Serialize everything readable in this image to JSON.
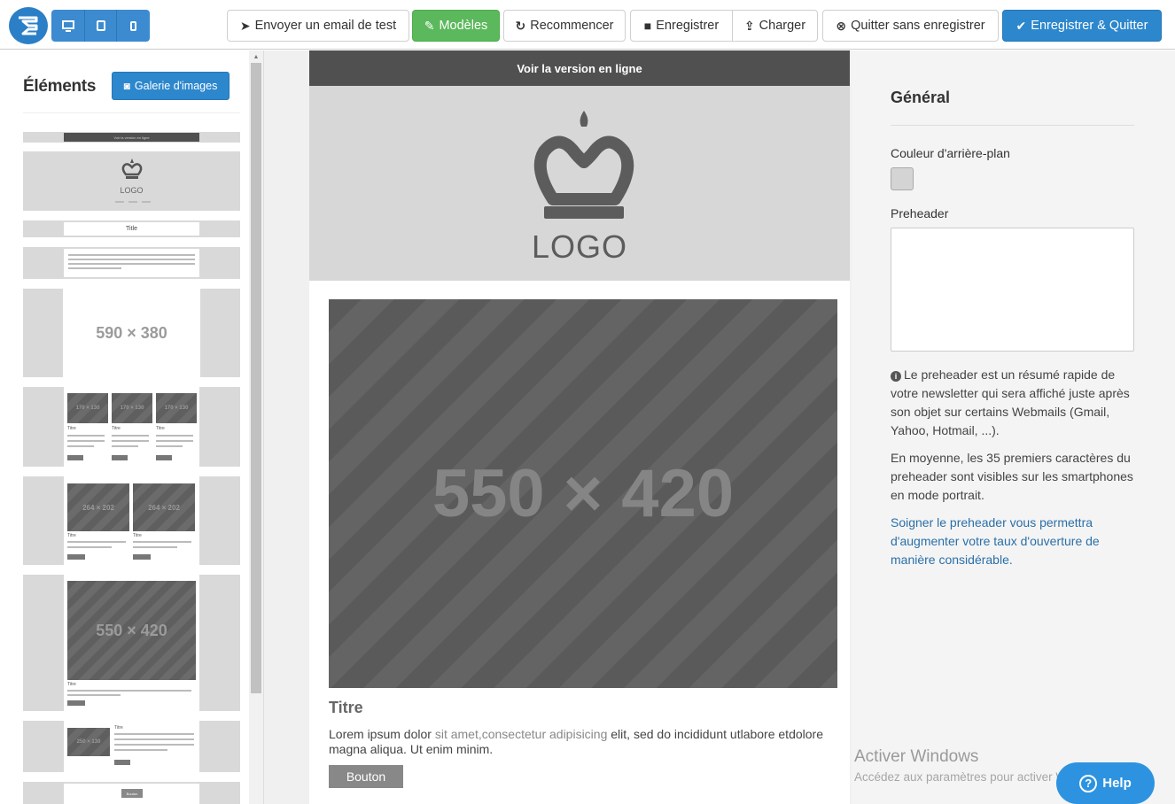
{
  "toolbar": {
    "device_buttons": [
      "desktop-icon",
      "tablet-icon",
      "mobile-icon"
    ],
    "send_test": "Envoyer un email de test",
    "templates": "Modèles",
    "restart": "Recommencer",
    "save": "Enregistrer",
    "load": "Charger",
    "quit_nosave": "Quitter sans enregistrer",
    "save_quit": "Enregistrer & Quitter"
  },
  "left": {
    "title": "Éléments",
    "gallery": "Galerie d'images",
    "thumb_online": "Voir la version en ligne",
    "thumb_logo": "LOGO",
    "thumb_title": "Title",
    "thumb_img_590": "590 × 380",
    "thumb_img_170": "170 × 130",
    "thumb_img_264": "264 × 202",
    "thumb_img_550": "550 × 420",
    "thumb_img_250": "250 × 130",
    "thumb_titre": "Titre",
    "thumb_button": "Bouton"
  },
  "canvas": {
    "online_link": "Voir la version en ligne",
    "logo_text": "LOGO",
    "image_size": "550 × 420",
    "title": "Titre",
    "text_1": "Lorem ipsum dolor ",
    "text_2": "sit amet,consectetur adipisicing",
    "text_3": " elit, sed do incididunt utlabore etdolore magna aliqua. Ut enim minim.",
    "button": "Bouton"
  },
  "right": {
    "title": "Général",
    "bg_color_label": "Couleur d'arrière-plan",
    "bg_color": "#d4d4d4",
    "preheader_label": "Preheader",
    "preheader_value": "",
    "info_1": "Le preheader est un résumé rapide de votre newsletter qui sera affiché juste après son objet sur certains Webmails (Gmail, Yahoo, Hotmail, ...).",
    "info_2": "En moyenne, les 35 premiers caractères du preheader sont visibles sur les smartphones en mode portrait.",
    "info_3": "Soigner le preheader vous permettra d'augmenter votre taux d'ouverture de manière considérable."
  },
  "watermark": {
    "title": "Activer Windows",
    "sub": "Accédez aux paramètres pour activer Windows."
  },
  "help": "Help",
  "colors": {
    "primary": "#2d87cc",
    "success": "#5cb85c",
    "dark_bar": "#505050"
  }
}
